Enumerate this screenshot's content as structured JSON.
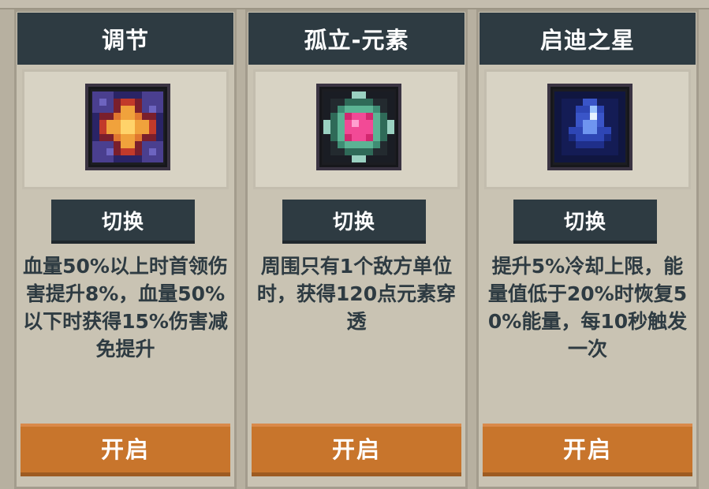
{
  "cards": [
    {
      "title": "调节",
      "icon": "sun-star-rune-icon",
      "switch_label": "切换",
      "description": "血量50%以上时首领伤害提升8%，血量50%以下时获得15%伤害减免提升",
      "open_label": "开启"
    },
    {
      "title": "孤立-元素",
      "icon": "pink-gem-rune-icon",
      "switch_label": "切换",
      "description": "周围只有1个敌方单位时，获得120点元素穿透",
      "open_label": "开启"
    },
    {
      "title": "启迪之星",
      "icon": "blue-crystal-rune-icon",
      "switch_label": "切换",
      "description": "提升5%冷却上限，能量值低于20%时恢复50%能量，每10秒触发一次",
      "open_label": "开启"
    }
  ],
  "colors": {
    "header_bg": "#2e3b42",
    "open_button": "#c8752c",
    "card_bg": "#c9c3b3",
    "text_dark": "#2e3b42"
  }
}
